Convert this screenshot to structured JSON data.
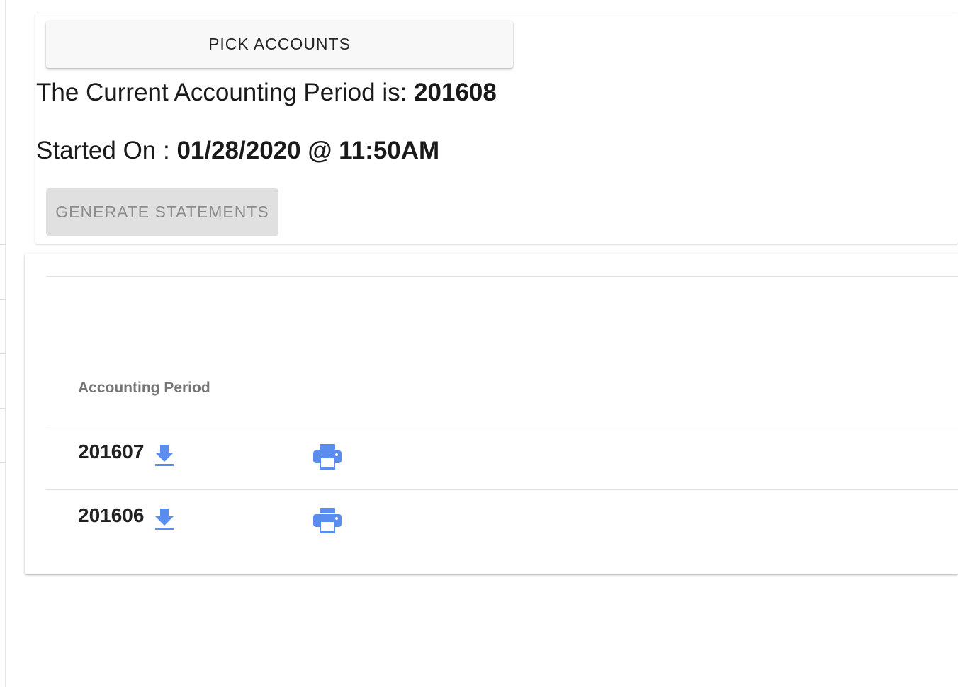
{
  "top_panel": {
    "pick_accounts_label": "PICK ACCOUNTS",
    "current_period_prefix": "The Current Accounting Period is: ",
    "current_period_value": "201608",
    "started_on_prefix": "Started On : ",
    "started_on_value": "01/28/2020 @ 11:50AM",
    "generate_statements_label": "GENERATE STATEMENTS"
  },
  "statements_table": {
    "column_header": "Accounting Period",
    "rows": [
      {
        "period": "201607",
        "download_icon": "download-icon",
        "print_icon": "print-icon"
      },
      {
        "period": "201606",
        "download_icon": "download-icon",
        "print_icon": "print-icon"
      }
    ]
  },
  "colors": {
    "icon_blue": "#5b8def",
    "disabled_button_bg": "#e0e0e0",
    "disabled_button_text": "#8c8c8c",
    "header_text": "#757575"
  }
}
